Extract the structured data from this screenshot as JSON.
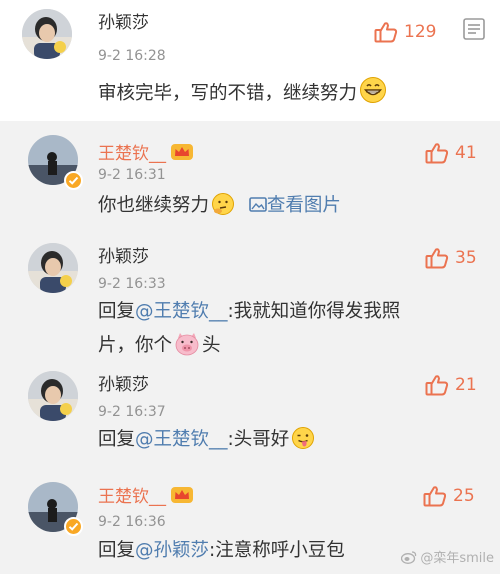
{
  "top_comment": {
    "user_name": "孙颖莎",
    "time": "9-2 16:28",
    "likes": "129",
    "text": "审核完毕，写的不错，继续努力",
    "emoji": "grinning-face"
  },
  "replies": [
    {
      "user_name": "王楚钦__",
      "time": "9-2 16:31",
      "likes": "41",
      "text": "你也继续努力",
      "emoji": "thinking-face",
      "link_text": "查看图片",
      "verified": true,
      "vip": true
    },
    {
      "user_name": "孙颖莎",
      "time": "9-2 16:33",
      "likes": "35",
      "reply_prefix": "回复",
      "mention": "@王楚钦__",
      "text_after_mention": ":我就知道你得发我照",
      "text_line2_a": "片，你个",
      "text_line2_b": "头",
      "emoji": "pig-face"
    },
    {
      "user_name": "孙颖莎",
      "time": "9-2 16:37",
      "likes": "21",
      "reply_prefix": "回复",
      "mention": "@王楚钦__",
      "text_after_mention": ":头哥好",
      "emoji": "tongue-face"
    },
    {
      "user_name": "王楚钦__",
      "time": "9-2 16:36",
      "likes": "25",
      "reply_prefix": "回复",
      "mention": "@孙颖莎",
      "text_after_mention": ":注意称呼小豆包",
      "verified": true,
      "vip": true
    }
  ],
  "watermark": "@栾年smile",
  "colors": {
    "like": "#eb7350",
    "mention": "#507daf",
    "vip_name": "#eb7350",
    "time": "#939393",
    "reply_bg": "#f2f2f2"
  }
}
